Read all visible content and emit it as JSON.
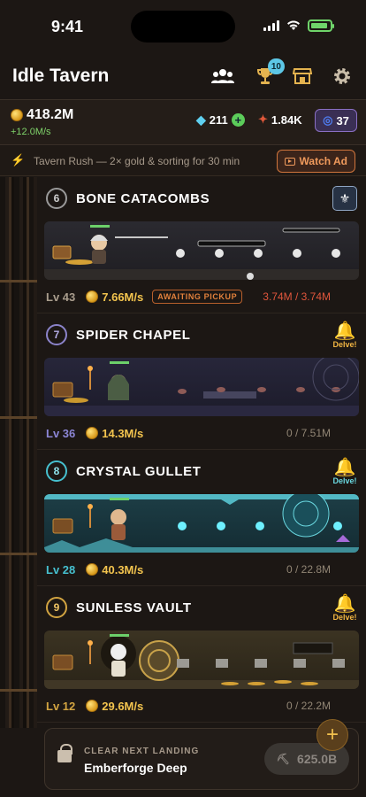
{
  "status_bar": {
    "time": "9:41"
  },
  "header": {
    "title": "Idle Tavern",
    "trophy_badge": "10"
  },
  "currency": {
    "gold": "418.2M",
    "gold_rate": "+12.0M/s",
    "gems": "211",
    "medals": "1.84K",
    "portals": "37"
  },
  "rush": {
    "text": "Tavern Rush — 2× gold & sorting for 30 min",
    "button": "Watch Ad"
  },
  "floors": [
    {
      "number": "6",
      "name": "BONE CATACOMBS",
      "level": "Lv 43",
      "rate": "7.66M/s",
      "status": "AWAITING PICKUP",
      "storage": "3.74M / 3.74M",
      "accent": "#9a9a9a"
    },
    {
      "number": "7",
      "name": "SPIDER CHAPEL",
      "level": "Lv 36",
      "rate": "14.3M/s",
      "storage": "0 / 7.51M",
      "action": "Delve!",
      "accent": "#8b83c9"
    },
    {
      "number": "8",
      "name": "CRYSTAL GULLET",
      "level": "Lv 28",
      "rate": "40.3M/s",
      "storage": "0 / 22.8M",
      "action": "Delve!",
      "accent": "#46c0cf"
    },
    {
      "number": "9",
      "name": "SUNLESS VAULT",
      "level": "Lv 12",
      "rate": "29.6M/s",
      "storage": "0 / 22.2M",
      "action": "Delve!",
      "accent": "#d2a441"
    }
  ],
  "next_landing": {
    "label": "CLEAR NEXT LANDING",
    "name": "Emberforge Deep",
    "cost": "625.0B"
  }
}
